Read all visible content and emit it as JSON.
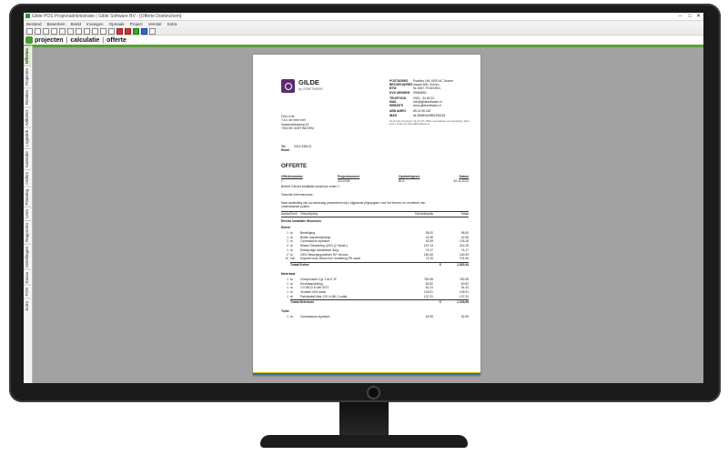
{
  "app": {
    "title": "Gilde POS Projectadministratie | Gilde Software BV - [Offerte Doetinchem]",
    "menu": [
      "Bestand",
      "Bewerken",
      "Beeld",
      "Invoegen",
      "Opmaak",
      "Project",
      "Venster",
      "Extra"
    ],
    "nav": [
      "projecten",
      "calculatie",
      "offerte"
    ],
    "window_controls": [
      "–",
      "□",
      "✕"
    ],
    "side_tabs": [
      "Offertes",
      "Projecten",
      "Relaties",
      "Artikelen",
      "Logistiek",
      "Kalender",
      "Orders",
      "Planning",
      "Uren",
      "Rapporten",
      "Instellingen",
      "Kassa",
      "POS",
      "Extra"
    ],
    "active_side_tab": 0,
    "colors": {
      "accent": "#5b9e3a",
      "logo": "#5a2d6e",
      "stripe_1": "#d4c400",
      "stripe_2": "#3b6aa0",
      "stripe_3": "#5b9e3a"
    }
  },
  "document": {
    "brand": "GILDE",
    "brand_sub": "by CRAFTWERK",
    "company_info": [
      {
        "k": "POSTADRES",
        "v": "Postbus 146, 6920 AC Duiven"
      },
      {
        "k": "BEZOEKADRES",
        "v": "Impact 60b, Duiven"
      },
      {
        "k": "BTW",
        "v": "NL 8047.79.619.B01"
      },
      {
        "k": "KVK ARNHEM",
        "v": "09065852"
      },
      {
        "k": "TELEFOON",
        "v": "0316 - 34 66 24"
      },
      {
        "k": "MAIL",
        "v": "info@gildesoftware.nl"
      },
      {
        "k": "WEBSITE",
        "v": "www.gildesoftware.nl"
      },
      {
        "k": "ABN AMRO",
        "v": "85.24.96.218"
      },
      {
        "k": "IBAN",
        "v": "NL38ABNA0852496218"
      }
    ],
    "terms_note": "Op al onze leveringen zijn de ICT~Office voorwaarden van toepassing. Deze kunt u vinden op www.gildesoftware.nl",
    "address": [
      "Fam. Kret",
      "T.a.v. de heer Kret",
      "Varsseveldseweg 34",
      "7004 BE DOETINCHEM"
    ],
    "contact": [
      {
        "k": "Tel",
        "v": "0314-336121"
      },
      {
        "k": "Email",
        "v": ""
      }
    ],
    "title": "OFFERTE",
    "meta_headers": [
      "Offertenummer",
      "Projectnummer",
      "Opdrachtgever",
      "Datum"
    ],
    "meta_values": [
      "1",
      "2011/049",
      "BLG",
      "30-11-2012"
    ],
    "subject": "Betreft: Electra installatie woonhuis versie 2",
    "salutation": "Geachte heer/mevrouw,",
    "intro_lines": [
      "Naar aanleiding van uw aanvraag presenteren wij u bijgaande prijsopgave voor het leveren en monteren van",
      "onderstaande posten."
    ],
    "table_headers": [
      "Aantal",
      "Eenh",
      "Omschrijving",
      "Eenheidsprijs",
      "Totaal"
    ],
    "section_title": "Electra installatie Woonhuis",
    "groups": [
      {
        "name": "Entree",
        "rows": [
          [
            "1",
            "st",
            "Beveiliging",
            "95.00",
            "95.00"
          ],
          [
            "1",
            "st",
            "Buiten wandlamp/lamp",
            "42.36",
            "42.36"
          ],
          [
            "2",
            "st",
            "Contrasdoos inpestort",
            "52.59",
            "105.18"
          ],
          [
            "2",
            "st",
            "Wissel Schakeling (USG (2 Schak.)",
            "157.13",
            "314.25"
          ],
          [
            "1",
            "st",
            "Enkelpolige schakelaar Jung",
            "74.17",
            "74.17"
          ],
          [
            "2",
            "st",
            "230V Bewegingsmelder 90° Inbouw",
            "180.49",
            "180.49"
          ],
          [
            "10",
            "mtr",
            "Koperen buis 28mm incl. montering PE zwart",
            "74.15",
            "741.50"
          ]
        ],
        "total_label": "Totaal Entree",
        "total_currency": "€",
        "total_value": "1.552,94"
      },
      {
        "name": "Meterkast",
        "rows": [
          [
            "1",
            "st",
            "Groepenkast 4 gr 1 ALS 1F",
            "780.35",
            "780.35"
          ],
          [
            "1",
            "st",
            "Hoofdaansluiting",
            "60.52",
            "60.52"
          ],
          [
            "1",
            "st",
            "2-V-WCD in MK 3071",
            "61.24",
            "61.24"
          ],
          [
            "1",
            "st",
            "Verdeler kit 6 aansl",
            "105.91",
            "105.91"
          ],
          [
            "1",
            "st",
            "Patchkabel Max 12V in MK 2 outlet",
            "137.31",
            "137.31"
          ]
        ],
        "total_label": "Totaal Meterkast",
        "total_currency": "€",
        "total_value": "1.229,98"
      },
      {
        "name": "Toilet",
        "rows": [
          [
            "1",
            "st",
            "Contrasdoos inpestort",
            "52.59",
            "52.59"
          ]
        ],
        "total_label": "",
        "total_currency": "",
        "total_value": ""
      }
    ]
  }
}
